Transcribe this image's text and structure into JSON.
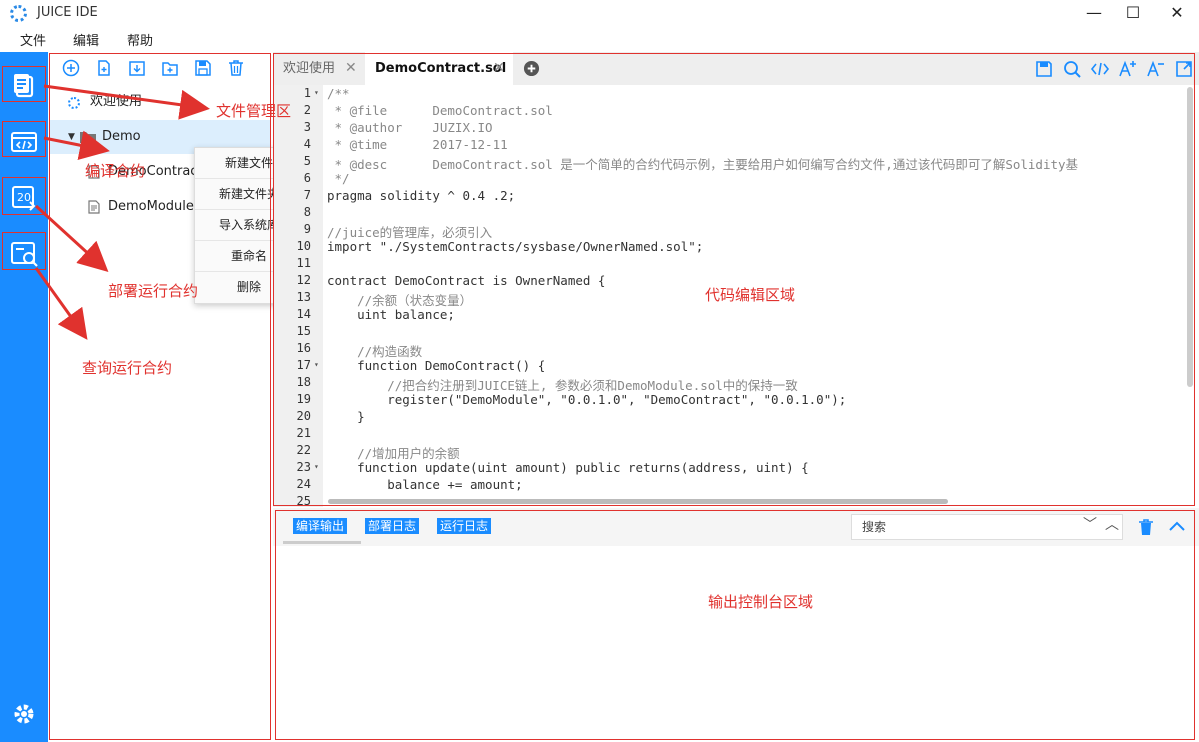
{
  "window": {
    "title": "JUICE IDE",
    "minimize": "—",
    "maximize": "☐",
    "close": "✕"
  },
  "menu": [
    "文件",
    "编辑",
    "帮助"
  ],
  "activity_bar": {
    "items": [
      "file-manager-icon",
      "compile-icon",
      "deploy-icon",
      "query-icon"
    ],
    "settings": "gear-icon",
    "accent": "#1a8cff"
  },
  "explorer": {
    "toolbar": [
      "add-circle-icon",
      "new-file-icon",
      "import-icon",
      "new-folder-icon",
      "save-icon",
      "delete-icon"
    ],
    "tree": [
      {
        "label": "欢迎使用",
        "icon": "juice-logo-icon"
      },
      {
        "label": "Demo",
        "icon": "folder-icon",
        "expanded": true,
        "selected": true
      },
      {
        "label": "DemoContract.sol",
        "icon": "file-icon"
      },
      {
        "label": "DemoModule.sol",
        "icon": "file-icon"
      }
    ]
  },
  "context_menu": [
    "新建文件",
    "新建文件夹",
    "导入系统库",
    "重命名",
    "删除"
  ],
  "tabs": [
    {
      "label": "欢迎使用",
      "active": false
    },
    {
      "label": "DemoContract.sol",
      "active": true
    }
  ],
  "code": {
    "lines": [
      "/**",
      " * @file      DemoContract.sol",
      " * @author    JUZIX.IO",
      " * @time      2017-12-11",
      " * @desc      DemoContract.sol 是一个简单的合约代码示例，主要给用户如何编写合约文件,通过该代码即可了解Solidity基",
      " */",
      "pragma solidity ^ 0.4 .2;",
      "",
      "//juice的管理库，必须引入",
      "import \"./SystemContracts/sysbase/OwnerNamed.sol\";",
      "",
      "contract DemoContract is OwnerNamed {",
      "    //余额（状态变量）",
      "    uint balance;",
      "",
      "    //构造函数",
      "    function DemoContract() {",
      "        //把合约注册到JUICE链上, 参数必须和DemoModule.sol中的保持一致",
      "        register(\"DemoModule\", \"0.0.1.0\", \"DemoContract\", \"0.0.1.0\");",
      "    }",
      "",
      "    //增加用户的余额",
      "    function update(uint amount) public returns(address, uint) {",
      "        balance += amount;",
      ""
    ],
    "line_numbers": [
      "1",
      "2",
      "3",
      "4",
      "5",
      "6",
      "7",
      "8",
      "9",
      "10",
      "11",
      "12",
      "13",
      "14",
      "15",
      "16",
      "17",
      "18",
      "19",
      "20",
      "21",
      "22",
      "23",
      "24",
      "25"
    ]
  },
  "console": {
    "tabs": [
      "编译输出",
      "部署日志",
      "运行日志"
    ],
    "search_placeholder": "搜索"
  },
  "annotations": {
    "file_manager": "文件管理区",
    "compile": "编译合约",
    "deploy": "部署运行合约",
    "query": "查询运行合约",
    "editor": "代码编辑区域",
    "console": "输出控制台区域"
  },
  "colors": {
    "annotation": "#e0322e",
    "accent": "#1a8cff"
  }
}
